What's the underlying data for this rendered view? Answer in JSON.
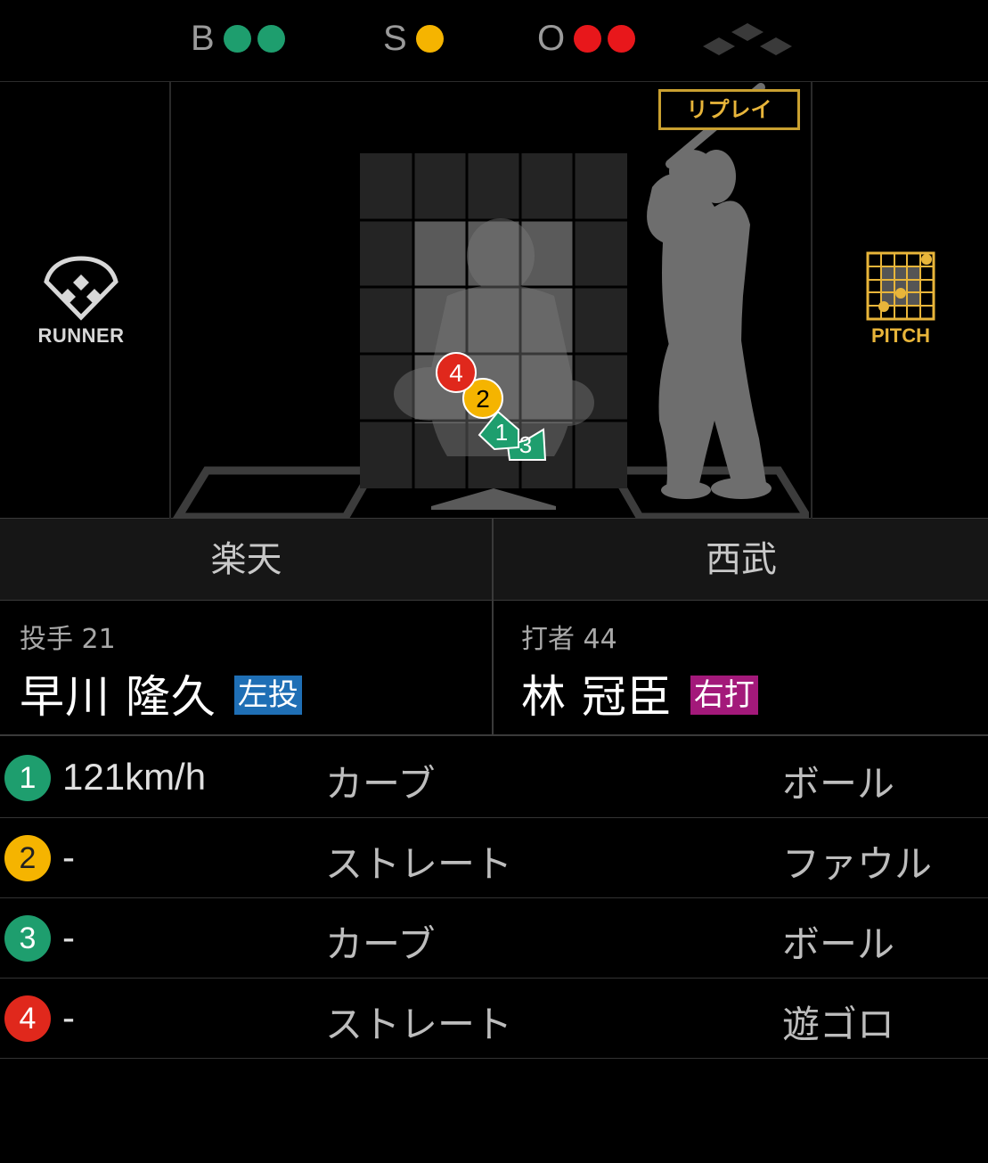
{
  "count": {
    "balls_label": "B",
    "strikes_label": "S",
    "outs_label": "O",
    "balls": 2,
    "strikes": 1,
    "outs": 2,
    "ball_color": "#1e9e6e",
    "strike_color": "#f5b400",
    "out_color": "#e8171b"
  },
  "field": {
    "replay_label": "リプレイ",
    "runner_label": "RUNNER",
    "pitch_label": "PITCH",
    "runner_icon": "diamond-field-icon",
    "pitch_icon": "strike-zone-grid-icon",
    "pitch_markers": [
      {
        "num": "4",
        "shape": "circle",
        "color": "#e0281c"
      },
      {
        "num": "2",
        "shape": "circle",
        "color": "#f5b400"
      },
      {
        "num": "1",
        "shape": "home-plate",
        "color": "#1e9e6e"
      },
      {
        "num": "3",
        "shape": "home-plate",
        "color": "#1e9e6e"
      }
    ]
  },
  "teams": {
    "home": "楽天",
    "away": "西武"
  },
  "pitcher": {
    "role": "投手 21",
    "name": "早川 隆久",
    "hand": "左投",
    "hand_color": "#1f6fb5"
  },
  "batter": {
    "role": "打者 44",
    "name": "林 冠臣",
    "hand": "右打",
    "hand_color": "#a3197a"
  },
  "pitches": [
    {
      "num": "1",
      "color": "#1e9e6e",
      "speed": "121km/h",
      "type": "カーブ",
      "result": "ボール"
    },
    {
      "num": "2",
      "color": "#f5b400",
      "speed": "-",
      "type": "ストレート",
      "result": "ファウル"
    },
    {
      "num": "3",
      "color": "#1e9e6e",
      "speed": "-",
      "type": "カーブ",
      "result": "ボール"
    },
    {
      "num": "4",
      "color": "#e0281c",
      "speed": "-",
      "type": "ストレート",
      "result": "遊ゴロ"
    }
  ]
}
